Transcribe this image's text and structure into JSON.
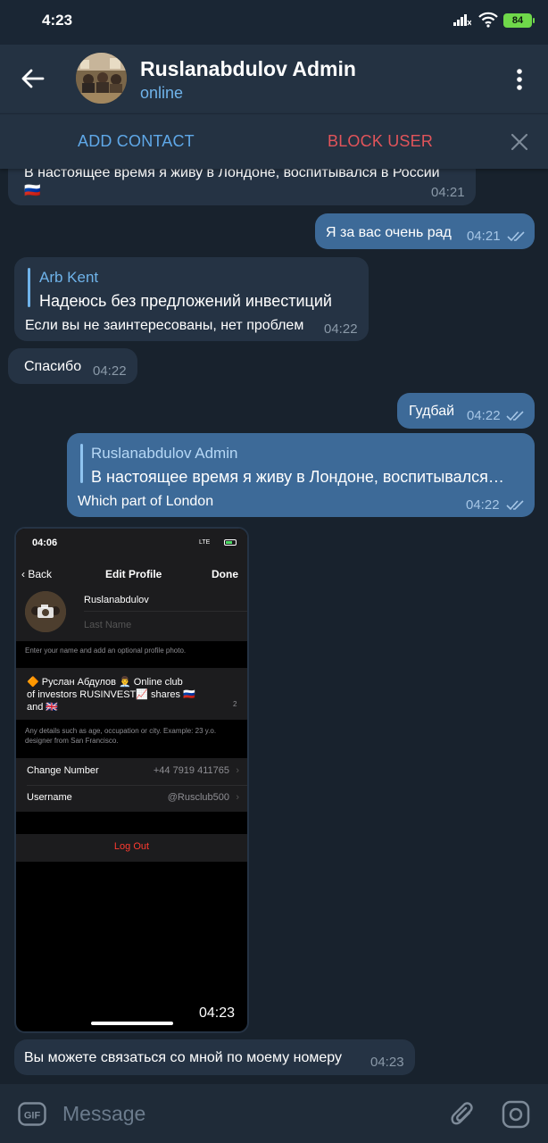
{
  "status_bar": {
    "time": "4:23",
    "battery": "84"
  },
  "header": {
    "title": "Ruslanabdulov Admin",
    "status": "online"
  },
  "actions": {
    "add_contact": "ADD CONTACT",
    "block_user": "BLOCK USER"
  },
  "messages": [
    {
      "dir": "in",
      "text": "В настоящее время я живу в Лондоне, воспитывался в России",
      "emoji": "🇷🇺",
      "time": "04:21"
    },
    {
      "dir": "out",
      "text": "Я за вас очень рад",
      "time": "04:21",
      "read": true
    },
    {
      "dir": "in",
      "reply_name": "Arb Kent",
      "reply_text": "Надеюсь без предложений инвестиций",
      "text": "Если вы не заинтересованы, нет проблем",
      "time": "04:22"
    },
    {
      "dir": "in",
      "text": "Спасибо",
      "time": "04:22"
    },
    {
      "dir": "out",
      "text": "Гудбай",
      "time": "04:22",
      "read": true
    },
    {
      "dir": "out",
      "reply_name": "Ruslanabdulov Admin",
      "reply_text": "В настоящее время я живу в Лондоне, воспитывался…",
      "text": "Which part of London",
      "time": "04:22",
      "read": true
    },
    {
      "dir": "in",
      "text": "Вы можете связаться со мной по моему номеру",
      "time": "04:23"
    }
  ],
  "media": {
    "video_time": "04:23",
    "screenshot": {
      "time": "04:06",
      "network": "LTE",
      "back": "Back",
      "title": "Edit Profile",
      "done": "Done",
      "first_name": "Ruslanabdulov",
      "last_name_placeholder": "Last Name",
      "name_hint": "Enter your name and add an optional profile photo.",
      "bio_line1": "🔶 Руслан Абдулов 👨‍💼 Online club",
      "bio_line2": "of investors RUSINVEST📈 shares 🇷🇺",
      "bio_line3": "and 🇬🇧",
      "bio_count": "2",
      "bio_hint": "Any details such as age, occupation or city. Example: 23 y.o. designer from San Francisco.",
      "change_number_label": "Change Number",
      "change_number_value": "+44 7919 411765",
      "username_label": "Username",
      "username_value": "@Rusclub500",
      "logout": "Log Out"
    }
  },
  "input": {
    "placeholder": "Message"
  },
  "colors": {
    "background": "#18222d",
    "header": "#243242",
    "bubble_in": "#253344",
    "bubble_out": "#3d6a98",
    "accent": "#6fb3ea",
    "danger": "#e2545a"
  }
}
